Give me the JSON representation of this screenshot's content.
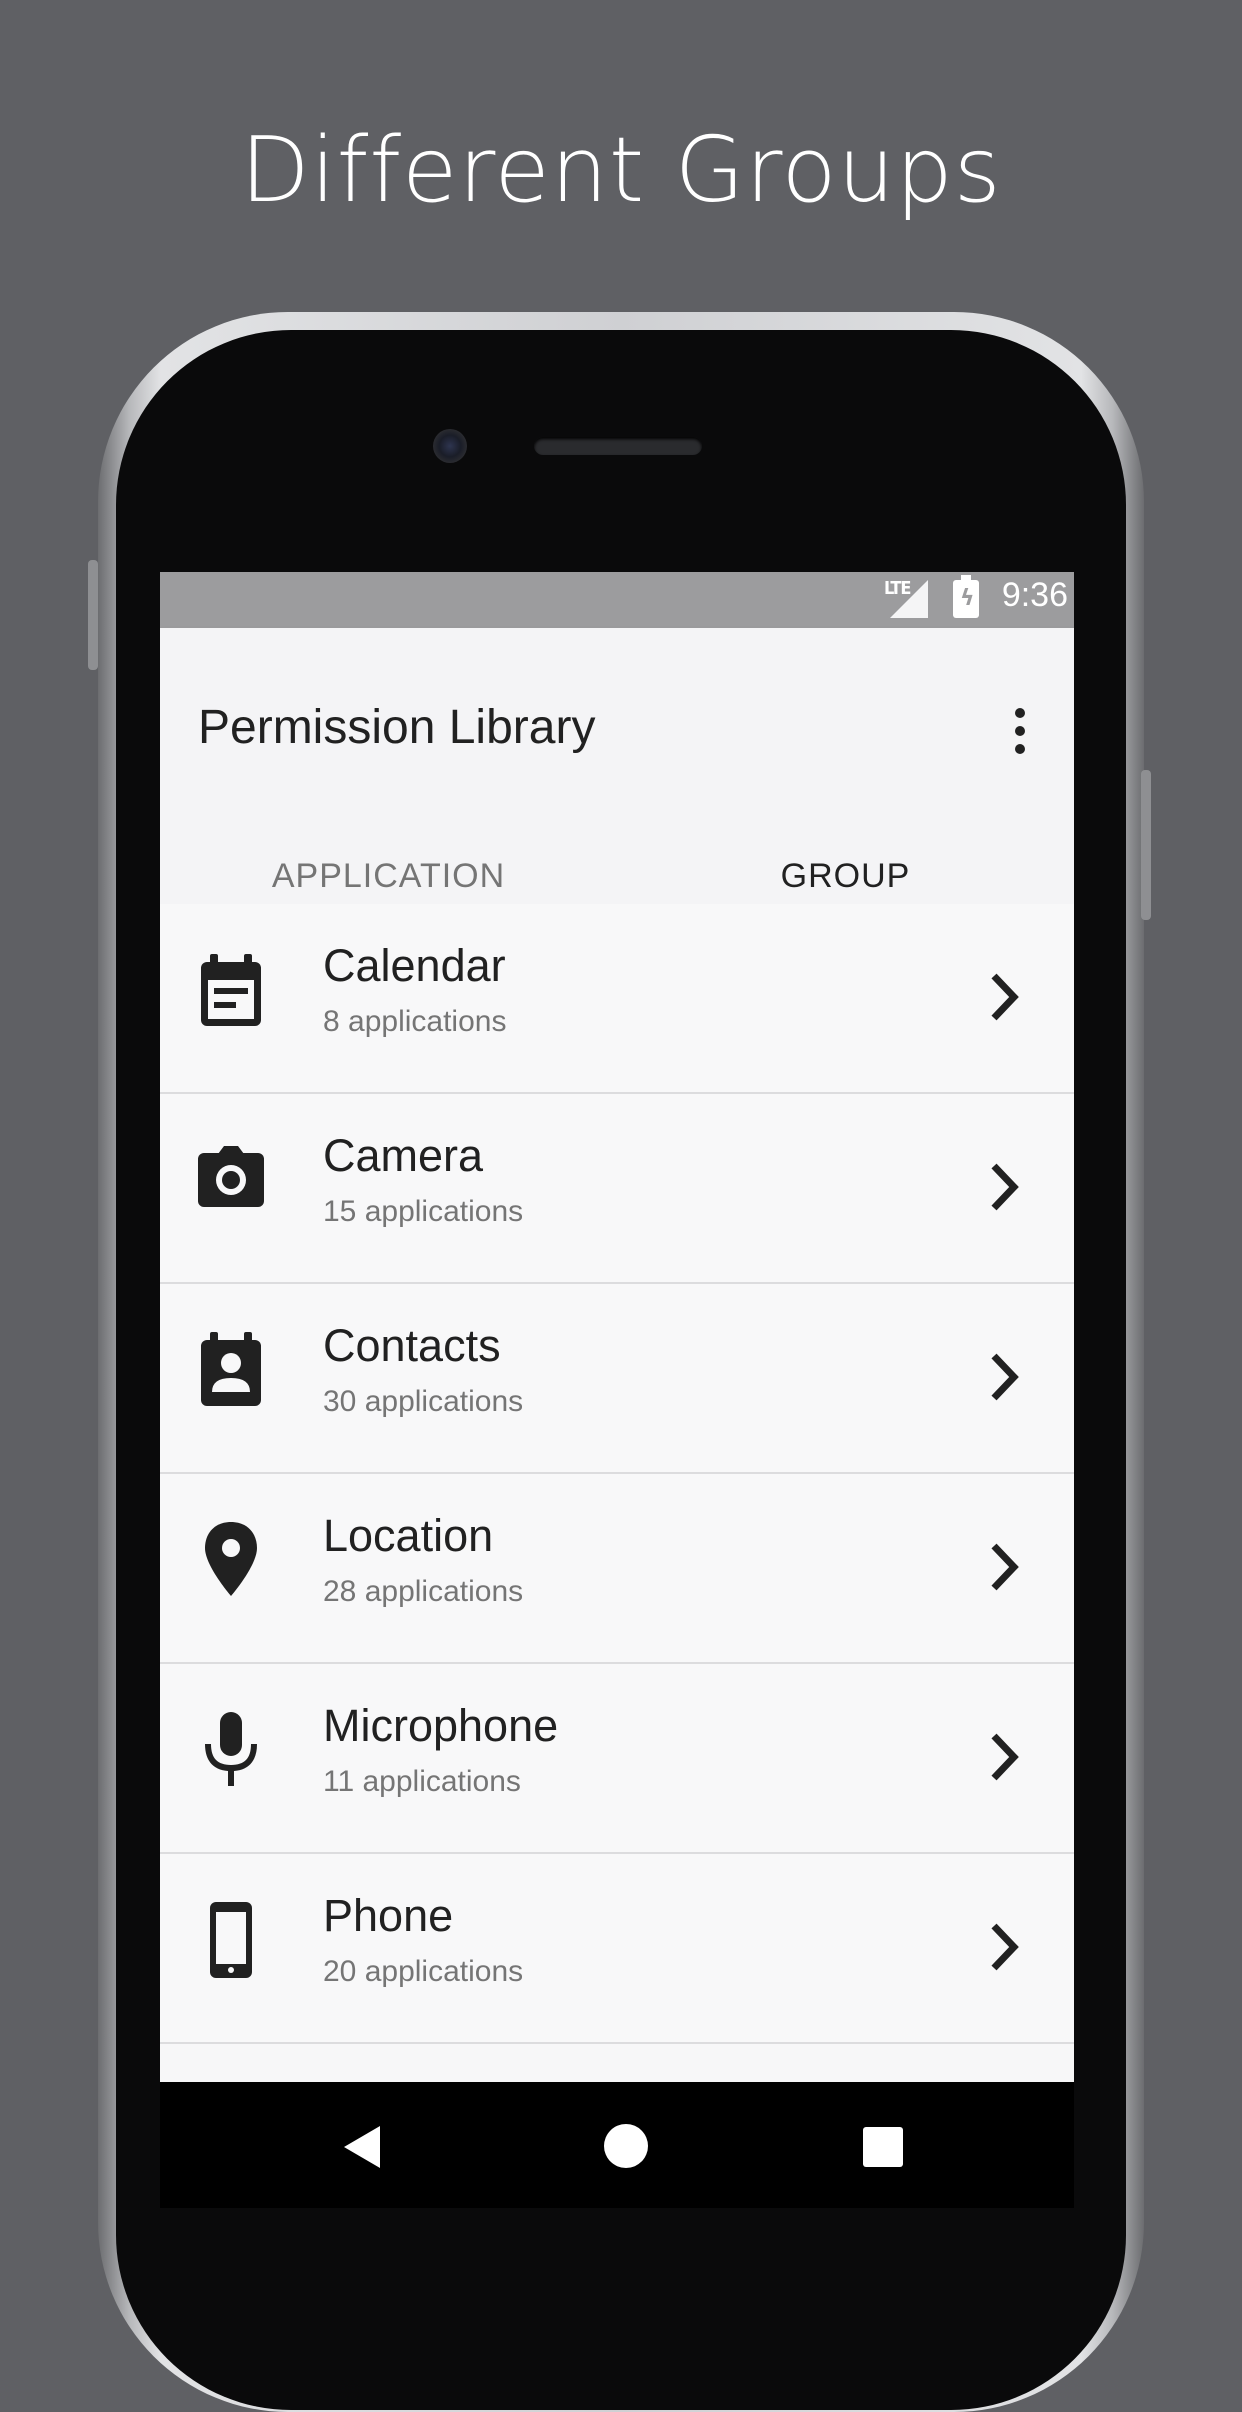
{
  "headline": "Different Groups",
  "status_bar": {
    "network": "LTE",
    "time": "9:36"
  },
  "app_bar": {
    "title": "Permission Library",
    "overflow_icon": "more-vert-icon"
  },
  "tabs": [
    {
      "label": "APPLICATION",
      "selected": false
    },
    {
      "label": "GROUP",
      "selected": true
    }
  ],
  "accent_color": "#f2a630",
  "groups": [
    {
      "name": "Calendar",
      "count": "8 applications",
      "icon": "calendar-icon"
    },
    {
      "name": "Camera",
      "count": "15 applications",
      "icon": "camera-icon"
    },
    {
      "name": "Contacts",
      "count": "30 applications",
      "icon": "contacts-icon"
    },
    {
      "name": "Location",
      "count": "28 applications",
      "icon": "location-pin-icon"
    },
    {
      "name": "Microphone",
      "count": "11 applications",
      "icon": "microphone-icon"
    },
    {
      "name": "Phone",
      "count": "20 applications",
      "icon": "phone-icon"
    }
  ],
  "nav_bar": [
    "back-icon",
    "home-icon",
    "recents-icon"
  ]
}
